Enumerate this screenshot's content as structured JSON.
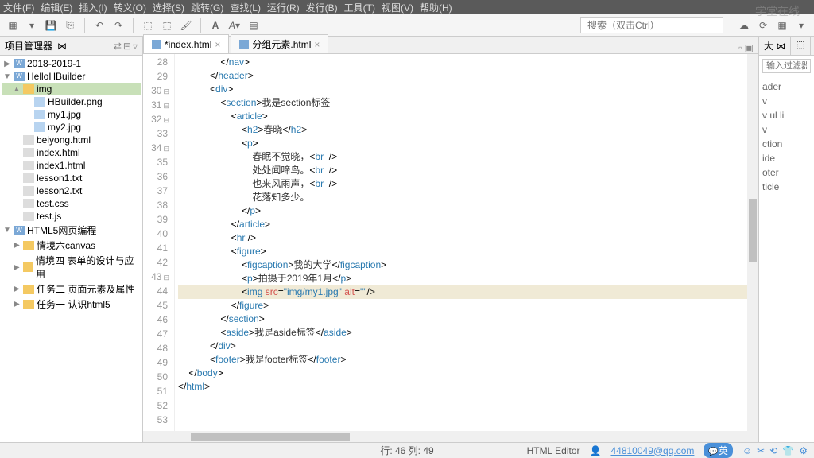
{
  "menu": {
    "file": "文件(F)",
    "edit": "编辑(E)",
    "insert": "插入(I)",
    "goto": "转义(O)",
    "select": "选择(S)",
    "jump": "跳转(G)",
    "find": "查找(L)",
    "run": "运行(R)",
    "publish": "发行(B)",
    "tools": "工具(T)",
    "view": "视图(V)",
    "help": "帮助(H)"
  },
  "toolbar": {
    "search_placeholder": "搜索（双击Ctrl）"
  },
  "watermark": "学堂在线",
  "project_panel": {
    "title": "项目管理器",
    "tree": [
      {
        "lvl": 0,
        "exp": "▶",
        "ico": "w",
        "label": "2018-2019-1"
      },
      {
        "lvl": 0,
        "exp": "▼",
        "ico": "w",
        "label": "HelloHBuilder"
      },
      {
        "lvl": 1,
        "exp": "▲",
        "ico": "folder",
        "label": "img",
        "sel": true
      },
      {
        "lvl": 2,
        "exp": "",
        "ico": "img",
        "label": "HBuilder.png"
      },
      {
        "lvl": 2,
        "exp": "",
        "ico": "img",
        "label": "my1.jpg"
      },
      {
        "lvl": 2,
        "exp": "",
        "ico": "img",
        "label": "my2.jpg"
      },
      {
        "lvl": 1,
        "exp": "",
        "ico": "file",
        "label": "beiyong.html"
      },
      {
        "lvl": 1,
        "exp": "",
        "ico": "file",
        "label": "index.html"
      },
      {
        "lvl": 1,
        "exp": "",
        "ico": "file",
        "label": "index1.html"
      },
      {
        "lvl": 1,
        "exp": "",
        "ico": "file",
        "label": "lesson1.txt"
      },
      {
        "lvl": 1,
        "exp": "",
        "ico": "file",
        "label": "lesson2.txt"
      },
      {
        "lvl": 1,
        "exp": "",
        "ico": "file",
        "label": "test.css"
      },
      {
        "lvl": 1,
        "exp": "",
        "ico": "file",
        "label": "test.js"
      },
      {
        "lvl": 0,
        "exp": "▼",
        "ico": "w",
        "label": "HTML5网页编程"
      },
      {
        "lvl": 1,
        "exp": "▶",
        "ico": "folder",
        "label": "情境六canvas"
      },
      {
        "lvl": 1,
        "exp": "▶",
        "ico": "folder",
        "label": "情境四 表单的设计与应用"
      },
      {
        "lvl": 1,
        "exp": "▶",
        "ico": "folder",
        "label": "任务二 页面元素及属性"
      },
      {
        "lvl": 1,
        "exp": "▶",
        "ico": "folder",
        "label": "任务一 认识html5"
      }
    ]
  },
  "editor": {
    "tabs": [
      {
        "label": "*index.html",
        "active": true
      },
      {
        "label": "分组元素.html",
        "active": false
      }
    ],
    "lines": [
      {
        "n": 28,
        "fold": "",
        "html": "                &lt;/<span class=t>nav</span>&gt;"
      },
      {
        "n": 29,
        "fold": "",
        "html": "            &lt;/<span class=t>header</span>&gt;"
      },
      {
        "n": 30,
        "fold": "⊟",
        "html": "            &lt;<span class=t>div</span>&gt;"
      },
      {
        "n": 31,
        "fold": "⊟",
        "html": "                &lt;<span class=t>section</span>&gt;<span class=tx>我是section标签</span>"
      },
      {
        "n": 32,
        "fold": "⊟",
        "html": "                    &lt;<span class=t>article</span>&gt;"
      },
      {
        "n": 33,
        "fold": "",
        "html": "                        &lt;<span class=t>h2</span>&gt;<span class=tx>春晓</span>&lt;/<span class=t>h2</span>&gt;"
      },
      {
        "n": 34,
        "fold": "⊟",
        "html": "                        &lt;<span class=t>p</span>&gt;"
      },
      {
        "n": 35,
        "fold": "",
        "html": "                            <span class=tx>春眠不觉晓，</span>&lt;<span class=t>br</span>  /&gt;"
      },
      {
        "n": 36,
        "fold": "",
        "html": "                            <span class=tx>处处闻啼鸟。</span>&lt;<span class=t>br</span>  /&gt;"
      },
      {
        "n": 37,
        "fold": "",
        "html": "                            <span class=tx>也来风雨声，</span>&lt;<span class=t>br</span>  /&gt;"
      },
      {
        "n": 38,
        "fold": "",
        "html": "                            <span class=tx>花落知多少。</span>"
      },
      {
        "n": 39,
        "fold": "",
        "html": "                        &lt;/<span class=t>p</span>&gt;"
      },
      {
        "n": 40,
        "fold": "",
        "html": ""
      },
      {
        "n": 41,
        "fold": "",
        "html": "                    &lt;/<span class=t>article</span>&gt;"
      },
      {
        "n": 42,
        "fold": "",
        "html": "                    &lt;<span class=t>hr</span> /&gt;"
      },
      {
        "n": 43,
        "fold": "⊟",
        "html": "                    &lt;<span class=t>figure</span>&gt;"
      },
      {
        "n": 44,
        "fold": "",
        "html": "                        &lt;<span class=t>figcaption</span>&gt;<span class=tx>我的大学</span>&lt;/<span class=t>figcaption</span>&gt;"
      },
      {
        "n": 45,
        "fold": "",
        "html": "                        &lt;<span class=t>p</span>&gt;<span class=tx>拍摄于2019年1月</span>&lt;/<span class=t>p</span>&gt;"
      },
      {
        "n": 46,
        "fold": "",
        "hl": true,
        "html": "                        &lt;<span class=t>img</span> <span class=a>src</span>=<span class=s>\"img/my1.jpg\"</span> <span class=a>alt</span>=<span class=s>\"\"</span>/&gt;"
      },
      {
        "n": 47,
        "fold": "",
        "html": "                    &lt;/<span class=t>figure</span>&gt;"
      },
      {
        "n": 48,
        "fold": "",
        "html": "                &lt;/<span class=t>section</span>&gt;"
      },
      {
        "n": 49,
        "fold": "",
        "html": "                &lt;<span class=t>aside</span>&gt;<span class=tx>我是aside标签</span>&lt;/<span class=t>aside</span>&gt;"
      },
      {
        "n": 50,
        "fold": "",
        "html": "            &lt;/<span class=t>div</span>&gt;"
      },
      {
        "n": 51,
        "fold": "",
        "html": "            &lt;<span class=t>footer</span>&gt;<span class=tx>我是footer标签</span>&lt;/<span class=t>footer</span>&gt;"
      },
      {
        "n": 52,
        "fold": "",
        "html": "    &lt;/<span class=t>body</span>&gt;"
      },
      {
        "n": 53,
        "fold": "",
        "html": "&lt;/<span class=t>html</span>&gt;"
      }
    ]
  },
  "outline": {
    "tab1": "大 ⋈",
    "tab2": "⬚",
    "filter_placeholder": "输入过滤器文本",
    "items": [
      "ader",
      "v",
      "v ul li",
      "v",
      "ction",
      "ide",
      "oter",
      "ticle"
    ]
  },
  "status": {
    "pos": "行: 46 列: 49",
    "mode": "HTML Editor",
    "user": "44810049@qq.com",
    "ime": "英"
  }
}
